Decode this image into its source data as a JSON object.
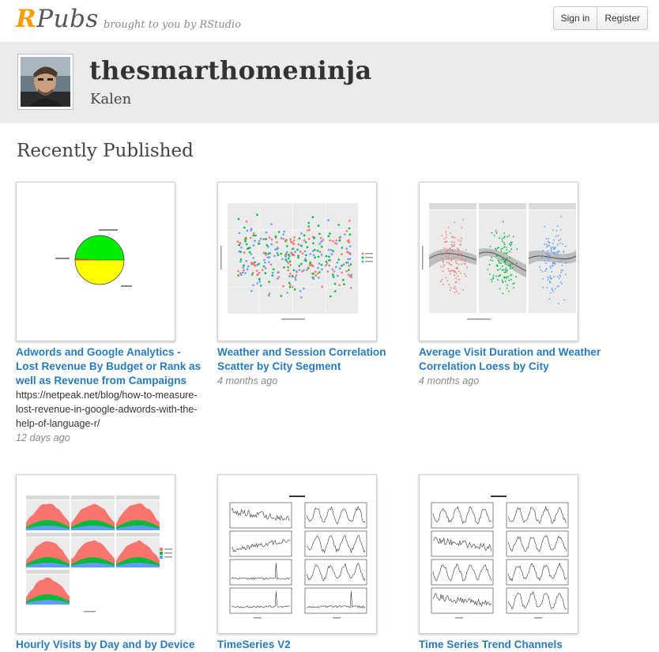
{
  "header": {
    "logo_r": "R",
    "logo_rest": "Pubs",
    "tagline": "brought to you by RStudio",
    "sign_in": "Sign in",
    "register": "Register"
  },
  "profile": {
    "username": "thesmarthomeninja",
    "name": "Kalen"
  },
  "section_title": "Recently Published",
  "publications": [
    {
      "title": "Adwords and Google Analytics - Lost Revenue By Budget or Rank as well as Revenue from Campaigns",
      "description": "https://netpeak.net/blog/how-to-measure-lost-revenue-in-google-adwords-with-the-help-of-language-r/",
      "date": "12 days ago",
      "thumbnail": "pie-chart-thumbnail"
    },
    {
      "title": "Weather and Session Correlation Scatter by City Segment",
      "date": "4 months ago",
      "thumbnail": "scatter-plot-thumbnail"
    },
    {
      "title": "Average Visit Duration and Weather Correlation Loess by City",
      "date": "4 months ago",
      "thumbnail": "faceted-loess-thumbnail"
    },
    {
      "title": "Hourly Visits by Day and by Device",
      "thumbnail": "stacked-area-facets-thumbnail"
    },
    {
      "title": "TimeSeries V2",
      "thumbnail": "time-series-thumbnail"
    },
    {
      "title": "Time Series Trend Channels",
      "thumbnail": "trend-channels-thumbnail"
    }
  ]
}
